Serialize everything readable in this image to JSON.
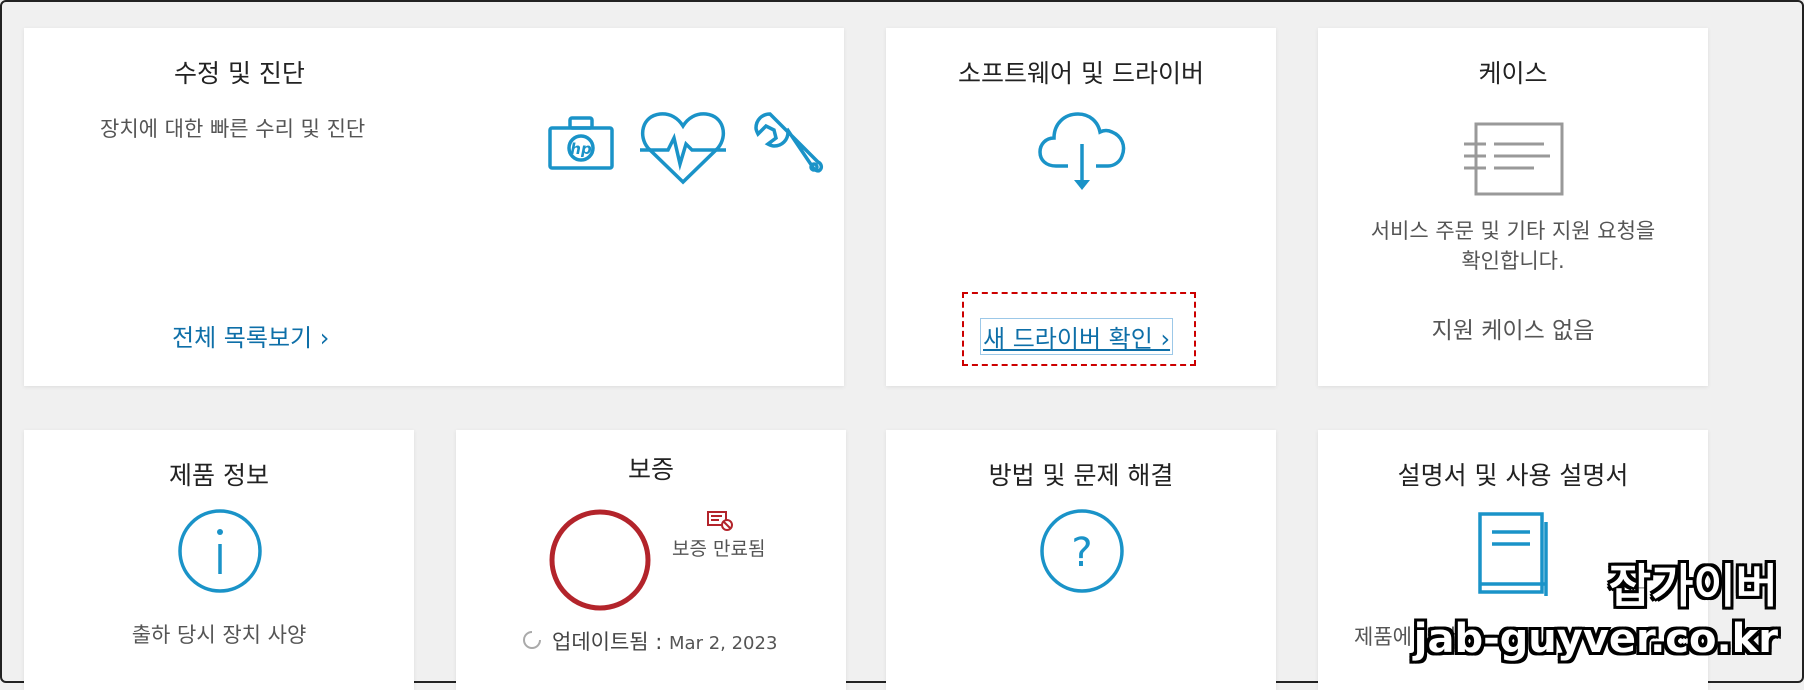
{
  "cards": {
    "repair": {
      "title": "수정 및 진단",
      "subtitle": "장치에 대한 빠른 수리 및 진단",
      "link": "전체 목록보기 ›",
      "hp_logo": "hp"
    },
    "software": {
      "title": "소프트웨어 및 드라이버",
      "link": "새 드라이버 확인 ›"
    },
    "cases": {
      "title": "케이스",
      "desc_line1": "서비스 주문 및 기타 지원 요청을",
      "desc_line2": "확인합니다.",
      "status": "지원 케이스 없음"
    },
    "product": {
      "title": "제품 정보",
      "subtitle": "출하 당시 장치 사양"
    },
    "warranty": {
      "title": "보증",
      "status": "보증 만료됨",
      "updated_label": "업데이트됨 : ",
      "updated_date": "Mar 2, 2023"
    },
    "howto": {
      "title": "방법 및 문제 해결"
    },
    "manuals": {
      "title": "설명서 및 사용 설명서",
      "subtitle": "제품에 대한"
    }
  },
  "watermark": {
    "line1": "잡가이버",
    "line2": "jab-guyver.co.kr"
  },
  "colors": {
    "accent": "#1a93c8",
    "link": "#0e6fa8",
    "warranty_ring": "#b3242b",
    "highlight_dash": "#cc0000"
  },
  "icons": [
    "hp-toolbox-icon",
    "heartbeat-icon",
    "wrench-icon",
    "cloud-download-icon",
    "document-icon",
    "info-icon",
    "refresh-icon",
    "warranty-expired-icon",
    "help-icon",
    "manual-book-icon"
  ]
}
